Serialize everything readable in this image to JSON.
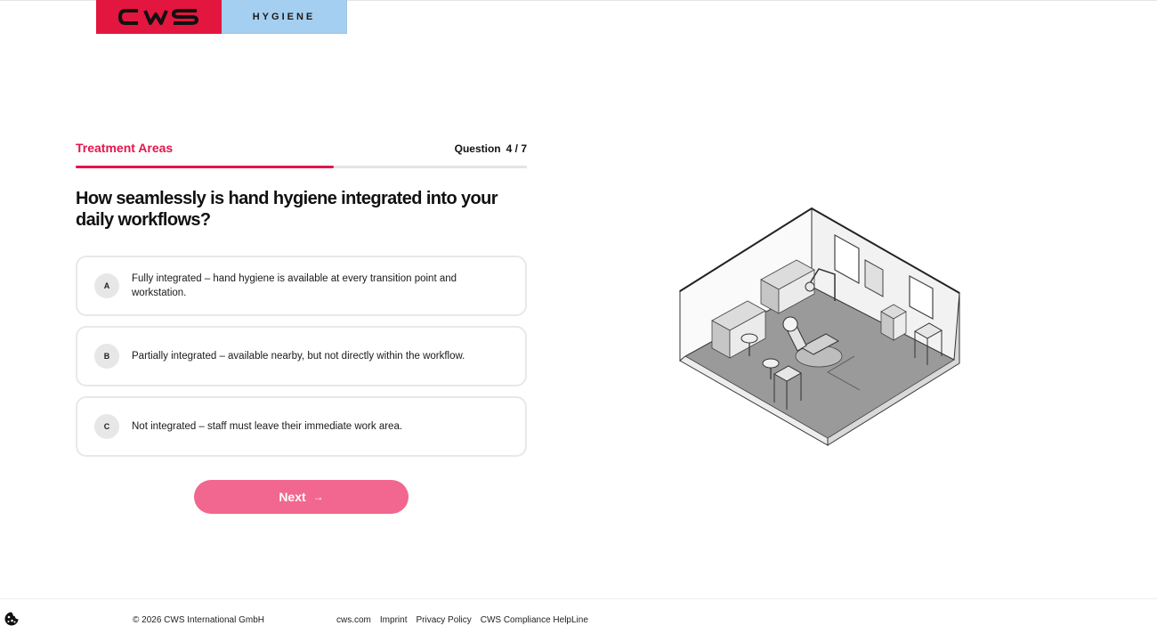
{
  "header": {
    "logo_text": "CWS",
    "logo_subtitle": "HYGIENE",
    "brand_color": "#e3163f",
    "subtitle_bg": "#a5cff0"
  },
  "quiz": {
    "section_title": "Treatment Areas",
    "counter_label": "Question",
    "counter_value": "4 / 7",
    "progress": {
      "current": 4,
      "total": 7
    },
    "question": "How seamlessly is hand hygiene integrated into your daily workflows?",
    "options": [
      {
        "letter": "A",
        "text": "Fully integrated – hand hygiene is available at every transition point and workstation."
      },
      {
        "letter": "B",
        "text": "Partially integrated – available nearby, but not directly within the workflow."
      },
      {
        "letter": "C",
        "text": "Not integrated – staff must leave their immediate work area."
      }
    ],
    "next_label": "Next",
    "next_icon": "arrow-right-icon",
    "accent_color": "#e3164b"
  },
  "illustration": {
    "icon": "isometric-treatment-room-illustration"
  },
  "footer": {
    "copyright": "© 2026 CWS International GmbH",
    "links": [
      {
        "label": "cws.com"
      },
      {
        "label": "Imprint"
      },
      {
        "label": "Privacy Policy"
      },
      {
        "label": "CWS Compliance HelpLine"
      }
    ],
    "cookie_icon": "cookie-icon"
  }
}
